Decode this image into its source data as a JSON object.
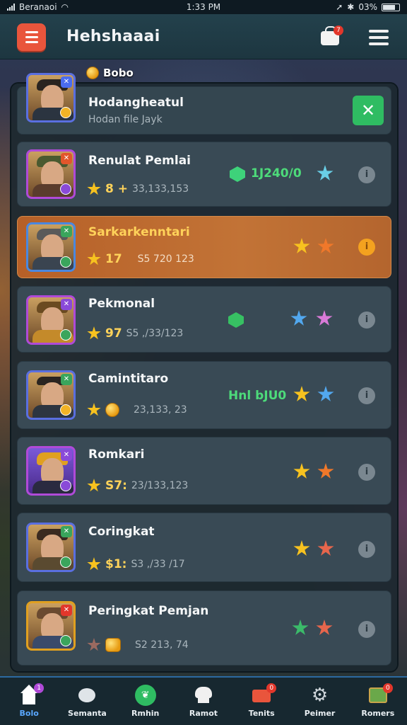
{
  "status_bar": {
    "carrier": "Beranaoi",
    "time": "1:33 PM",
    "battery": "03%"
  },
  "header": {
    "title": "Hehshaaai",
    "notification_count": "7"
  },
  "top_chip": {
    "label": "Bobo"
  },
  "rows": [
    {
      "name": "Hodangheatul",
      "sub": "Hodan file Jayk",
      "action": "✕"
    },
    {
      "name": "Renulat Pemlai",
      "level": "8 +",
      "score": "33,133,153",
      "extra": "1J240/0",
      "stars": [
        "cyan"
      ],
      "info": "i"
    },
    {
      "name": "Sarkarkenntari",
      "level": "17",
      "score": "S5 720 123",
      "stars": [
        "gold",
        "orange"
      ],
      "info": "i",
      "highlighted": true
    },
    {
      "name": "Pekmonal",
      "level": "97",
      "score": "S5 ,/33/123",
      "stars": [
        "blue",
        "pink"
      ],
      "info": "i"
    },
    {
      "name": "Camintitaro",
      "level": "",
      "score": "23,133, 23",
      "extra": "Hnl bJU0",
      "stars": [
        "gold",
        "blue"
      ],
      "info": "i"
    },
    {
      "name": "Romkari",
      "level": "S7:",
      "score": "23/133,123",
      "stars": [
        "gold",
        "orange"
      ],
      "info": "i"
    },
    {
      "name": "Coringkat",
      "level": "$1:",
      "score": "S3 ,/33 /17",
      "stars": [
        "gold",
        "coral"
      ],
      "info": "i"
    },
    {
      "name": "Peringkat Pemjan",
      "level": "",
      "score": "S2 213, 74",
      "stars": [
        "green",
        "coral"
      ],
      "info": "i"
    }
  ],
  "tabs": [
    {
      "label": "Bolo",
      "icon": "home-icon",
      "active": true,
      "badge": "1"
    },
    {
      "label": "Semanta",
      "icon": "fish-icon"
    },
    {
      "label": "Rmhin",
      "icon": "leaf-icon"
    },
    {
      "label": "Ramot",
      "icon": "chef-hat-icon"
    },
    {
      "label": "Tenits",
      "icon": "mail-icon",
      "badge": "0"
    },
    {
      "label": "Peimer",
      "icon": "gear-icon"
    },
    {
      "label": "Romers",
      "icon": "map-icon",
      "badge": "0"
    }
  ],
  "colors": {
    "accent": "#e9553c",
    "highlight_row": "#c27336",
    "confirm": "#2fbc62",
    "tab_active": "#5aa8ff"
  }
}
